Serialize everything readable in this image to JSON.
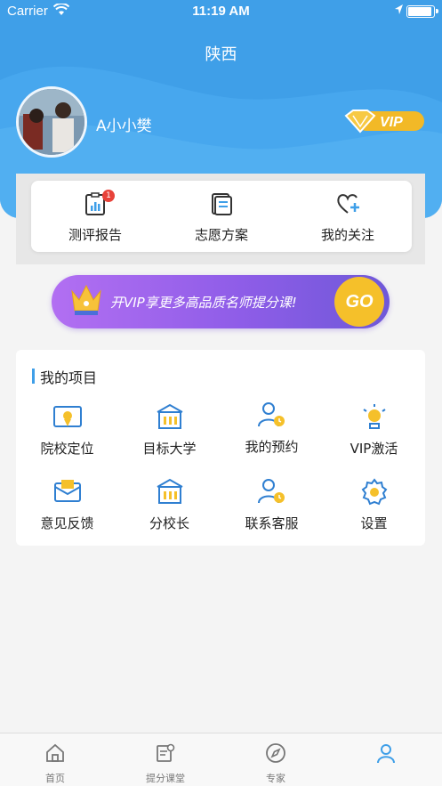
{
  "status_bar": {
    "carrier": "Carrier",
    "time": "11:19 AM"
  },
  "header": {
    "city": "陕西",
    "username": "A小小樊",
    "vip_badge": "VIP"
  },
  "quick_actions": [
    {
      "label": "测评报告",
      "icon": "report-icon",
      "badge": "1"
    },
    {
      "label": "志愿方案",
      "icon": "document-icon"
    },
    {
      "label": "我的关注",
      "icon": "heart-plus-icon"
    }
  ],
  "vip_banner": {
    "text": "开VIP享更多高品质名师提分课!",
    "go_label": "GO"
  },
  "projects": {
    "title": "我的项目",
    "items": [
      {
        "label": "院校定位",
        "icon": "school-locate-icon"
      },
      {
        "label": "目标大学",
        "icon": "university-icon"
      },
      {
        "label": "我的预约",
        "icon": "appointment-icon"
      },
      {
        "label": "VIP激活",
        "icon": "bulb-icon"
      },
      {
        "label": "意见反馈",
        "icon": "feedback-icon"
      },
      {
        "label": "分校长",
        "icon": "building-icon"
      },
      {
        "label": "联系客服",
        "icon": "service-icon"
      },
      {
        "label": "设置",
        "icon": "settings-icon"
      }
    ]
  },
  "tabbar": [
    {
      "label": "首页",
      "icon": "home-icon"
    },
    {
      "label": "提分课堂",
      "icon": "classroom-icon"
    },
    {
      "label": "专家",
      "icon": "compass-icon"
    },
    {
      "label": "",
      "icon": "profile-icon"
    }
  ],
  "colors": {
    "primary": "#3f9fe8",
    "vip_gold": "#f5c02a",
    "banner_purple": "#9a62ec",
    "badge_red": "#e8423a"
  }
}
